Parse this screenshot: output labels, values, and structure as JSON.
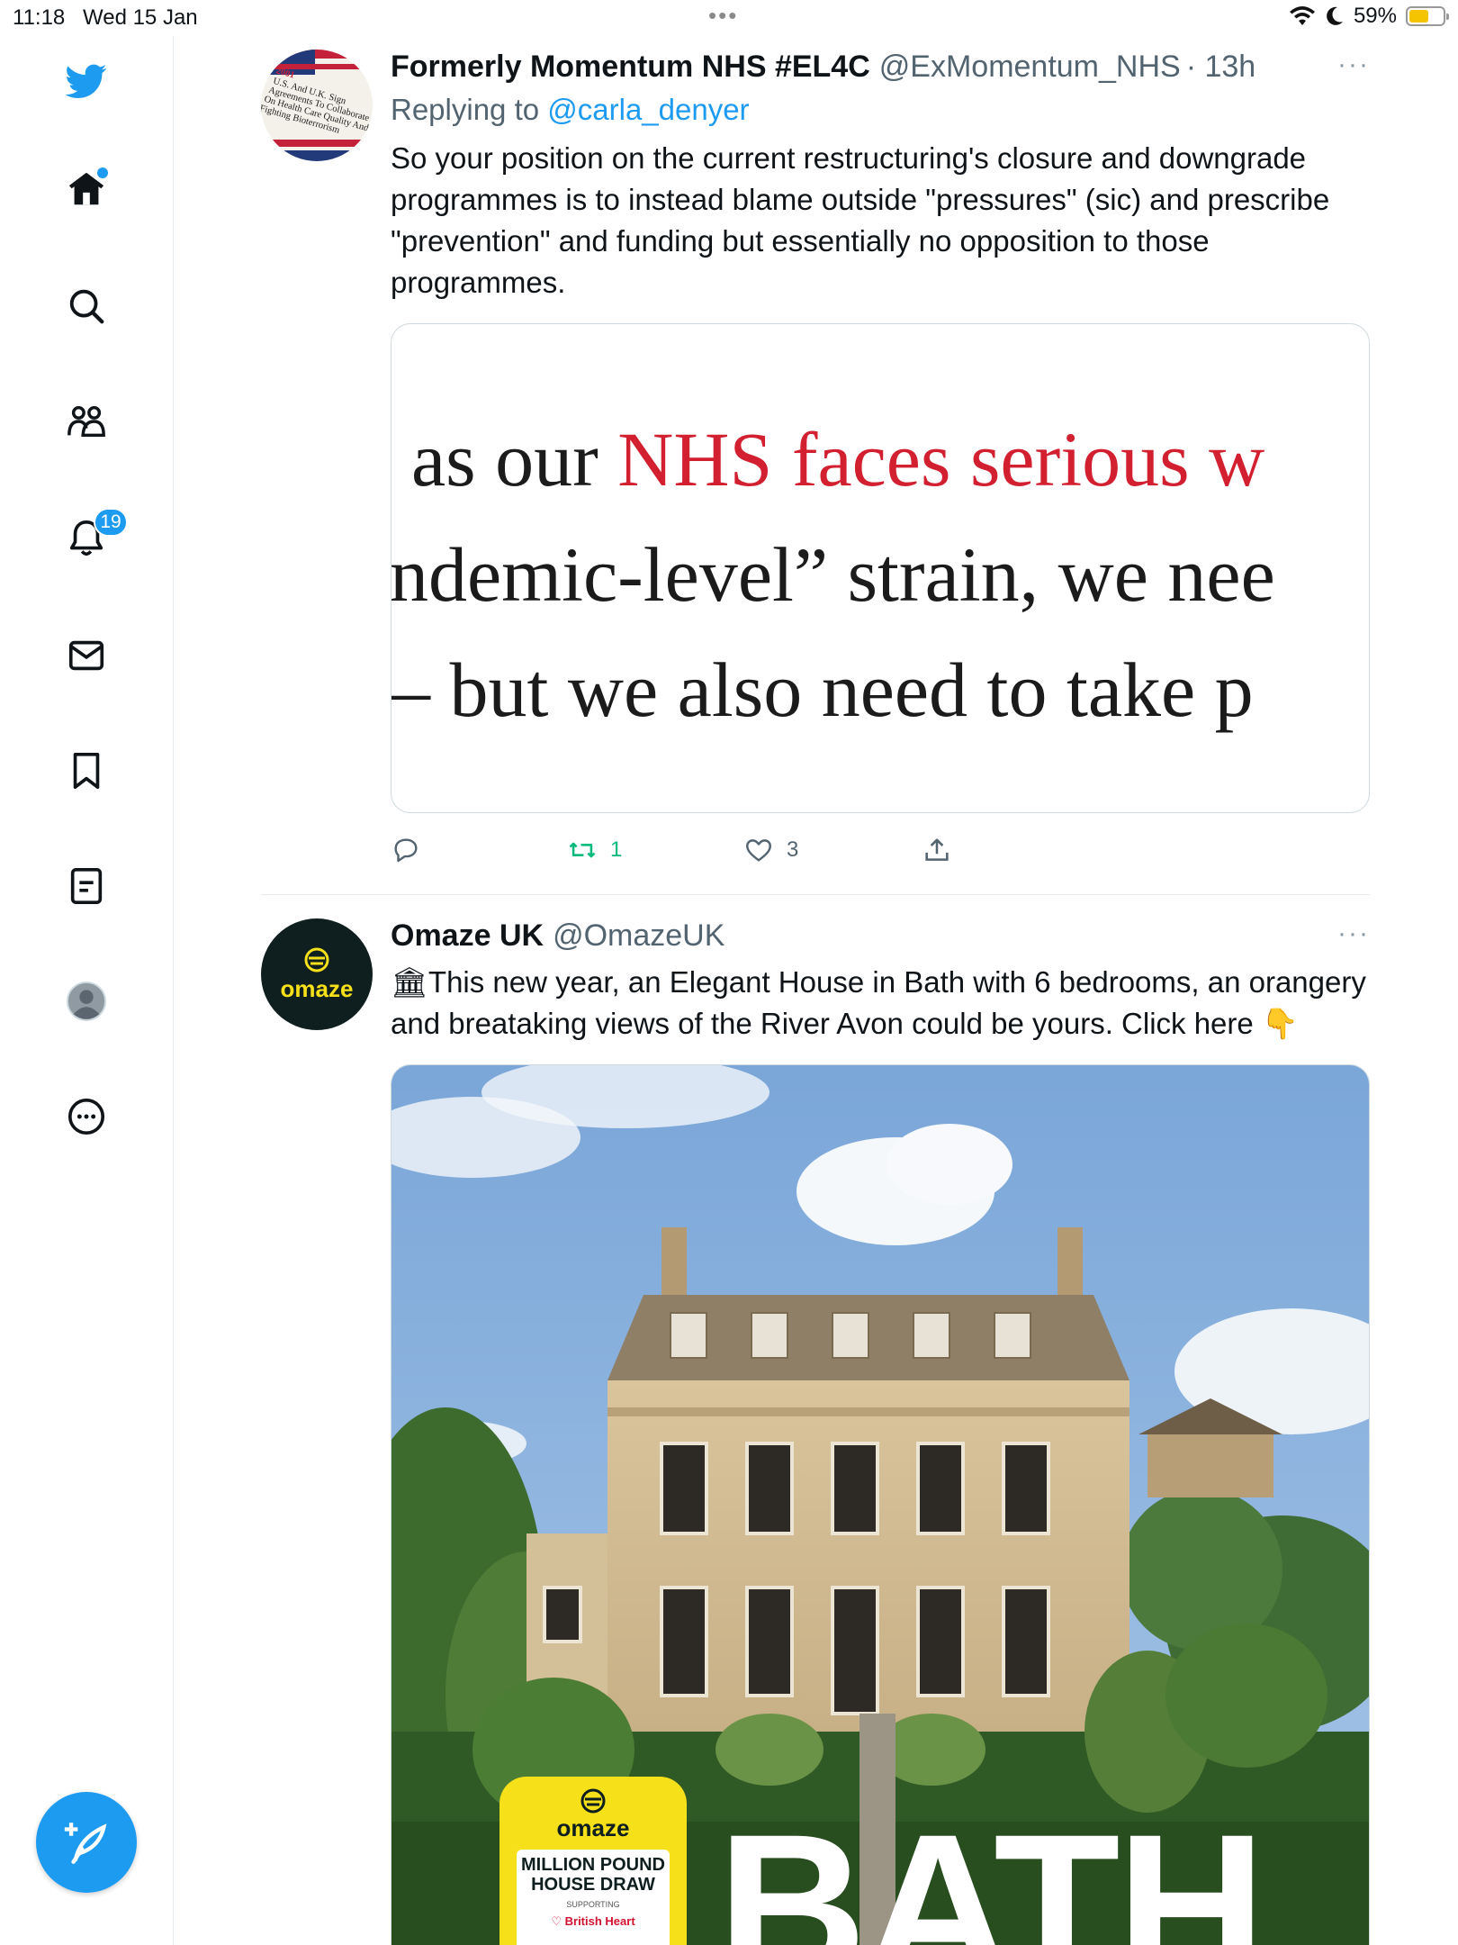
{
  "status_bar": {
    "time": "11:18",
    "date": "Wed 15 Jan",
    "battery": "59%",
    "battery_level": 0.59
  },
  "sidebar": {
    "items": [
      {
        "icon": "twitter-logo-icon"
      },
      {
        "icon": "home-icon",
        "has_dot": true
      },
      {
        "icon": "search-icon"
      },
      {
        "icon": "communities-icon"
      },
      {
        "icon": "bell-icon",
        "badge": "19"
      },
      {
        "icon": "mail-icon"
      },
      {
        "icon": "bookmark-icon"
      },
      {
        "icon": "lists-icon"
      },
      {
        "icon": "profile-icon"
      },
      {
        "icon": "more-icon"
      }
    ],
    "compose_icon": "compose-feather-icon"
  },
  "tweet1": {
    "name": "Formerly Momentum NHS #EL4C",
    "handle": "@ExMomentum_NHS",
    "time": "· 13h",
    "more": "···",
    "replying_prefix": "Replying to ",
    "replying_to": "@carla_denyer",
    "text": "So your position on the current restructuring's closure and downgrade programmes is to instead blame outside \"pressures\" (sic) and prescribe \"prevention\" and funding but essentially no opposition to those programmes.",
    "avatar_text": [
      "2001",
      "U.S. And U.K. Sign",
      "Agreements To Collaborate",
      "On Health Care Quality And",
      "Fighting Bioterrorism"
    ],
    "image": {
      "line1_black": "as our ",
      "line1_red": "NHS faces serious w",
      "line2": "ndemic-level” strain, we nee",
      "line3": "– but we also need to take p"
    },
    "actions": {
      "reply": "",
      "retweets": "1",
      "likes": "3",
      "share": ""
    },
    "colors": {
      "retweet_green": "#00ba7c",
      "quote_red": "#d32030"
    }
  },
  "tweet2": {
    "name": "Omaze UK",
    "handle": "@OmazeUK",
    "more": "···",
    "emoji_start": "🏛",
    "text": "This new year, an Elegant House in Bath with 6 bedrooms, an orangery and breataking views of the River Avon could be yours. Click here",
    "emoji_end": "👇",
    "avatar_label": "omaze",
    "image": {
      "badge_brand": "omaze",
      "badge_title": "MILLION POUND HOUSE DRAW",
      "badge_supporting": "SUPPORTING",
      "badge_charity": "British Heart",
      "headline": "BATH"
    }
  }
}
